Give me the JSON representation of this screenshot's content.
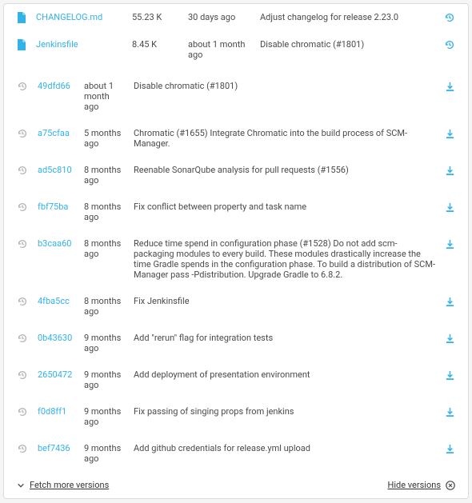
{
  "files": [
    {
      "name": "CHANGELOG.md",
      "size": "55.23 K",
      "date": "30 days ago",
      "msg": "Adjust changelog for release 2.23.0"
    },
    {
      "name": "Jenkinsfile",
      "size": "8.45 K",
      "date": "about 1 month ago",
      "msg": "Disable chromatic (#1801)"
    }
  ],
  "commits": [
    {
      "hash": "49dfd66",
      "date": "about 1 month ago",
      "msg": "Disable chromatic (#1801)"
    },
    {
      "hash": "a75cfaa",
      "date": "5 months ago",
      "msg": "Chromatic (#1655) Integrate Chromatic into the build process of SCM-Manager."
    },
    {
      "hash": "ad5c810",
      "date": "8 months ago",
      "msg": "Reenable SonarQube analysis for pull requests (#1556)"
    },
    {
      "hash": "fbf75ba",
      "date": "8 months ago",
      "msg": "Fix conflict between property and task name"
    },
    {
      "hash": "b3caa60",
      "date": "8 months ago",
      "msg": "Reduce time spend in configuration phase (#1528) Do not add scm-packaging modules to every build. These modules drastically increase the time Gradle spends in the configuration phase. To build a distribution of SCM-Manager pass -Pdistribution. Upgrade Gradle to 6.8.2."
    },
    {
      "hash": "4fba5cc",
      "date": "8 months ago",
      "msg": "Fix Jenkinsfile"
    },
    {
      "hash": "0b43630",
      "date": "9 months ago",
      "msg": "Add \"rerun\" flag for integration tests"
    },
    {
      "hash": "2650472",
      "date": "9 months ago",
      "msg": "Add deployment of presentation environment"
    },
    {
      "hash": "f0d8ff1",
      "date": "9 months ago",
      "msg": "Fix passing of singing props from jenkins"
    },
    {
      "hash": "bef7436",
      "date": "9 months ago",
      "msg": "Add github credentials for release.yml upload"
    }
  ],
  "footer": {
    "fetch_more": "Fetch more versions",
    "hide_versions": "Hide versions"
  }
}
